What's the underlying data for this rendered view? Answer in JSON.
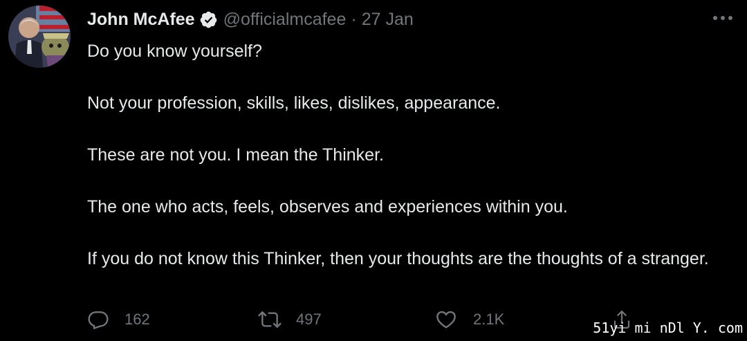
{
  "tweet": {
    "display_name": "John McAfee",
    "handle": "@officialmcafee",
    "separator": "·",
    "date": "27 Jan",
    "verified": true,
    "paragraphs": [
      "Do you know yourself?",
      "Not your profession, skills, likes, dislikes, appearance.",
      "These are not you. I mean the Thinker.",
      "The one who acts, feels, observes and experiences within you.",
      "If you do not know this Thinker, then your thoughts are the thoughts of a stranger."
    ]
  },
  "actions": {
    "reply_count": "162",
    "retweet_count": "497",
    "like_count": "2.1K"
  },
  "icons": {
    "verified": "verified-badge-icon",
    "more": "more-options-icon",
    "reply": "reply-icon",
    "retweet": "retweet-icon",
    "like": "like-icon",
    "share": "share-icon"
  },
  "colors": {
    "background": "#000000",
    "text_primary": "#e7e9ea",
    "text_secondary": "#71767b"
  },
  "watermark": "51yi mi nDl Y. com"
}
